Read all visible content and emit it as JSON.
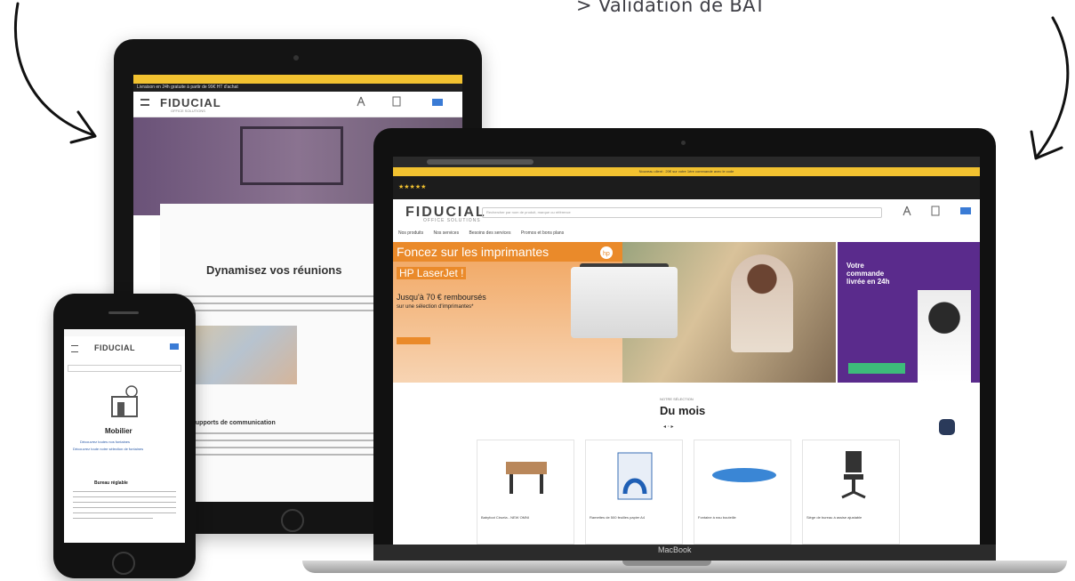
{
  "caption": "> Validation de BAT",
  "tablet": {
    "logo": "FIDUCIAL",
    "logo_sub": "OFFICE SOLUTIONS",
    "announce": "Livraison en 24h gratuite à partir de 99€ HT d'achat",
    "hero_title": "Dynamisez vos réunions",
    "section_title": "Les supports de communication"
  },
  "phone": {
    "logo": "FIDUCIAL",
    "category": "Mobilier",
    "link_1": "Découvrez toutes nos fontaines",
    "link_2": "Découvrez toute notre sélection de fontaines",
    "subtitle": "Bureau réglable"
  },
  "laptop": {
    "brand": "MacBook",
    "logo": "FIDUCIAL",
    "logo_sub": "OFFICE SOLUTIONS",
    "yellow_bar": "Nouveau client : 20€ sur votre 1ère commande avec le code",
    "search_placeholder": "Rechercher par nom de produit, marque ou référence",
    "nav_items": [
      "Nos produits",
      "Nos services",
      "Besoins des services",
      "Promos et bons plans"
    ],
    "banner_headline": "Foncez sur les imprimantes",
    "banner_product": "HP LaserJet !",
    "banner_price": "Jusqu'à 70 € remboursés",
    "banner_price_sub": "sur une sélection d'imprimantes*",
    "right_banner_title": "Votre commande livrée en 24h",
    "selection_label": "NOTRE SÉLECTION",
    "selection_title": "Du mois",
    "products": [
      "Babyfoot Ciruela - NEW OMNI",
      "Ramettes de 500 feuilles papier A4",
      "Fontaine à eau bouteille",
      "Siège de bureau à assise ajustable"
    ]
  }
}
